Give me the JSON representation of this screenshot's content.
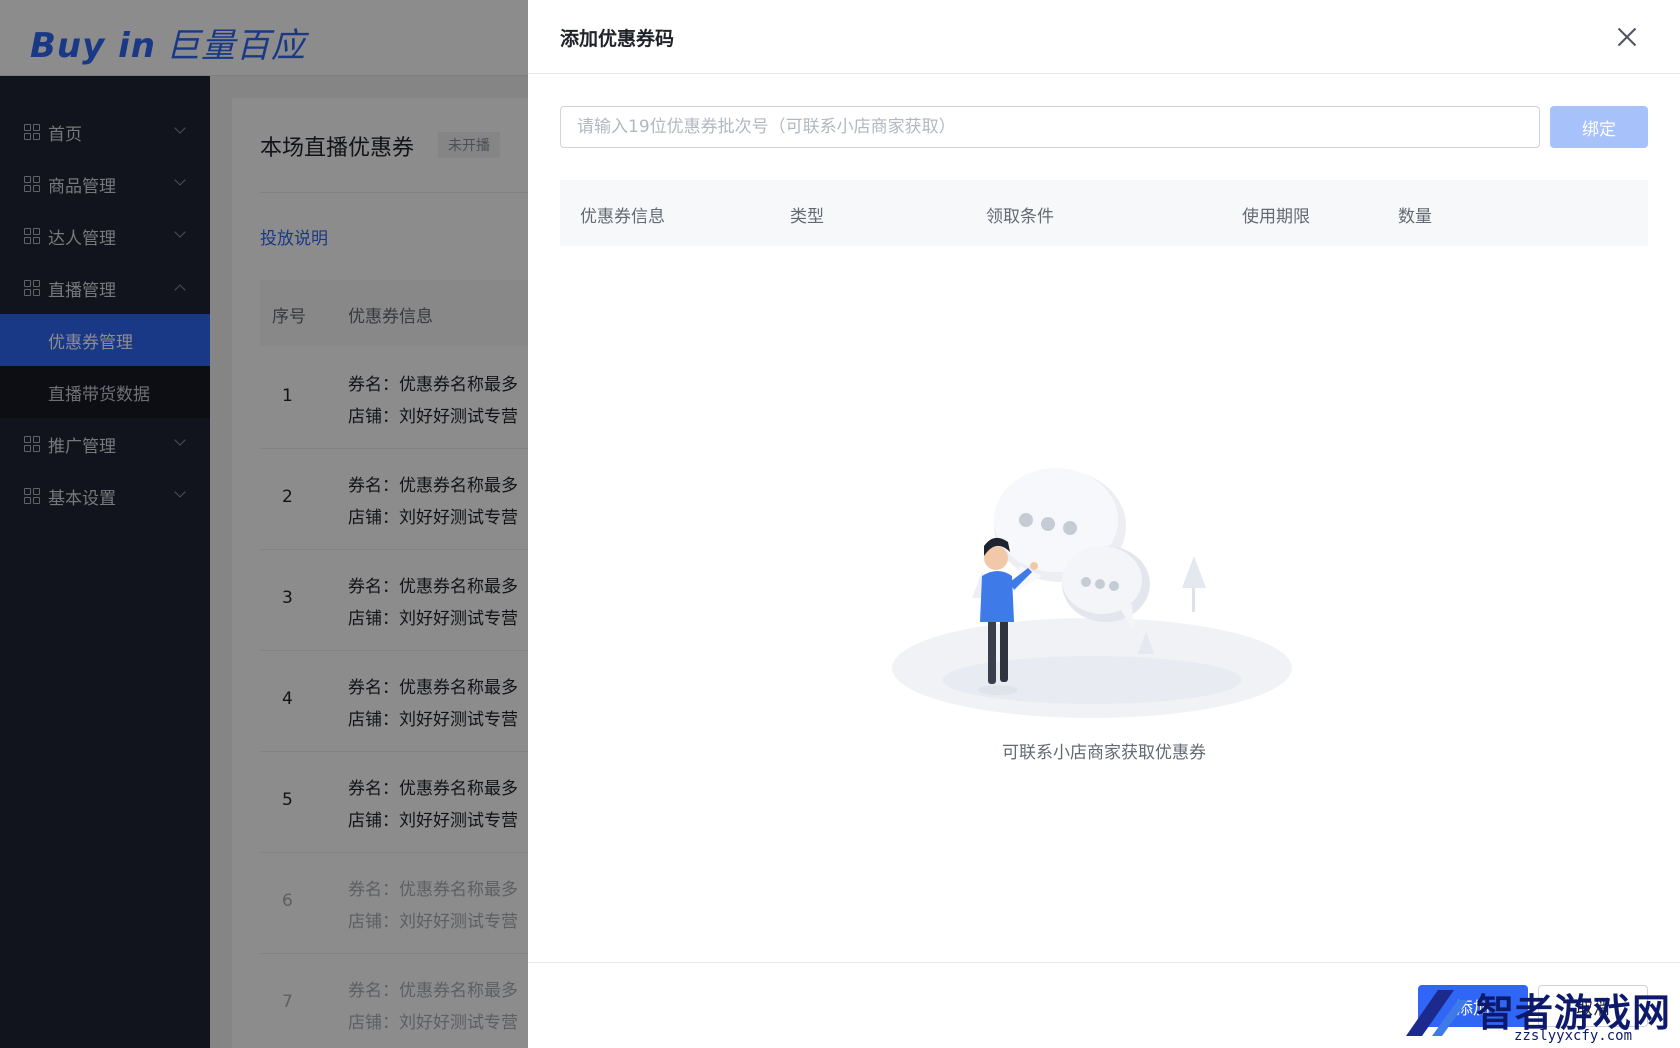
{
  "app": {
    "logo_en": "Buy in",
    "logo_cn": "巨量百应"
  },
  "sidebar": {
    "items": [
      {
        "label": "首页"
      },
      {
        "label": "商品管理"
      },
      {
        "label": "达人管理"
      },
      {
        "label": "直播管理"
      },
      {
        "label": "推广管理"
      },
      {
        "label": "基本设置"
      }
    ],
    "sub_items": [
      {
        "label": "优惠券管理",
        "active": true
      },
      {
        "label": "直播带货数据",
        "active": false
      }
    ]
  },
  "main": {
    "title": "本场直播优惠券",
    "status": "未开播",
    "help_link": "投放说明",
    "columns": {
      "index": "序号",
      "info": "优惠券信息"
    },
    "rows": [
      {
        "index": "1",
        "name": "券名：优惠券名称最多",
        "shop": "店铺：刘好好测试专营"
      },
      {
        "index": "2",
        "name": "券名：优惠券名称最多",
        "shop": "店铺：刘好好测试专营"
      },
      {
        "index": "3",
        "name": "券名：优惠券名称最多",
        "shop": "店铺：刘好好测试专营"
      },
      {
        "index": "4",
        "name": "券名：优惠券名称最多",
        "shop": "店铺：刘好好测试专营"
      },
      {
        "index": "5",
        "name": "券名：优惠券名称最多",
        "shop": "店铺：刘好好测试专营"
      },
      {
        "index": "6",
        "name": "券名：优惠券名称最多",
        "shop": "店铺：刘好好测试专营"
      },
      {
        "index": "7",
        "name": "券名：优惠券名称最多",
        "shop": "店铺：刘好好测试专营"
      }
    ]
  },
  "drawer": {
    "title": "添加优惠券码",
    "input_placeholder": "请输入19位优惠券批次号（可联系小店商家获取）",
    "bind_label": "绑定",
    "columns": {
      "info": "优惠券信息",
      "type": "类型",
      "condition": "领取条件",
      "period": "使用期限",
      "quantity": "数量"
    },
    "empty_text": "可联系小店商家获取优惠券",
    "footer": {
      "add_label": "添加",
      "cancel_label": "取消"
    }
  },
  "watermark": {
    "text": "智者游戏网",
    "sub": "zzslyyxcfy.com"
  },
  "colors": {
    "accent": "#2f66f5",
    "sidebar_bg": "#1f2533",
    "bind_disabled": "#a7c1fb"
  }
}
